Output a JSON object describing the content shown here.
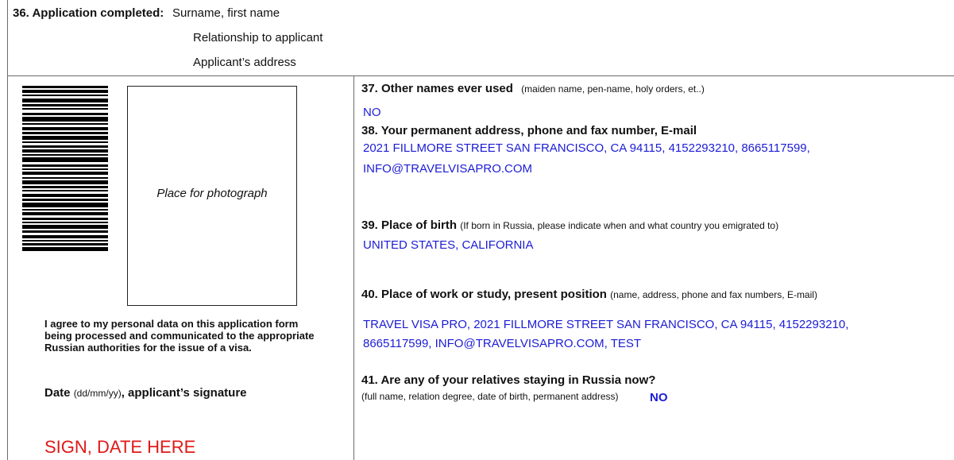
{
  "section36": {
    "label": "36. Application completed:",
    "line1": "Surname, first name",
    "line2": "Relationship to applicant",
    "line3": "Applicant’s address"
  },
  "photo": {
    "label": "Place for photograph"
  },
  "consent": {
    "text": "I agree to my personal data on this application form being processed and communicated to the appropriate Russian authorities for the issue of a visa.",
    "date_label": "Date",
    "date_hint": "(dd/mm/yy)",
    "signature_label": ", applicant’s signature",
    "sign_here": "SIGN, DATE HERE"
  },
  "q37": {
    "label": "37. Other names ever used",
    "hint": "(maiden name, pen-name, holy orders, et..)",
    "answer": "NO"
  },
  "q38": {
    "label": "38. Your permanent address, phone and fax number, E-mail",
    "answer_line1": "2021 FILLMORE STREET  SAN FRANCISCO, CA 94115, 4152293210, 8665117599,",
    "answer_line2": "INFO@TRAVELVISAPRO.COM"
  },
  "q39": {
    "label": "39. Place of birth",
    "hint": "(If born in Russia, please indicate when and what country you emigrated to)",
    "answer": "UNITED STATES, CALIFORNIA"
  },
  "q40": {
    "label": "40. Place of work or study, present position",
    "hint": "(name, address, phone and fax numbers, E-mail)",
    "answer_line1": "TRAVEL VISA PRO, 2021 FILLMORE STREET  SAN FRANCISCO, CA 94115, 4152293210,",
    "answer_line2": "8665117599, INFO@TRAVELVISAPRO.COM, TEST"
  },
  "q41": {
    "label": "41. Are any of your relatives staying in Russia now?",
    "hint": "(full name, relation degree, date of birth, permanent address)",
    "answer": "NO"
  },
  "colors": {
    "answer_blue": "#1c1cd6",
    "sign_red": "#e01818",
    "rule_gray": "#6b6b6b"
  }
}
